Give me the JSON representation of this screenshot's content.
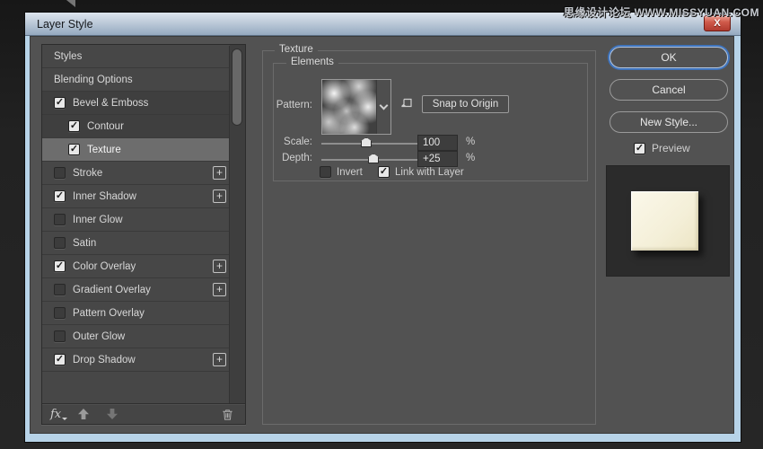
{
  "background": {
    "watermark": "思缘设计论坛 WWW.MISSYUAN.COM"
  },
  "dialog": {
    "title": "Layer Style"
  },
  "sidebar": {
    "items": [
      {
        "label": "Styles",
        "checkbox": null,
        "indent": false,
        "selected": false,
        "plus": false,
        "dark": false
      },
      {
        "label": "Blending Options",
        "checkbox": null,
        "indent": false,
        "selected": false,
        "plus": false,
        "dark": false
      },
      {
        "label": "Bevel & Emboss",
        "checkbox": true,
        "indent": false,
        "selected": false,
        "plus": false,
        "dark": true
      },
      {
        "label": "Contour",
        "checkbox": true,
        "indent": true,
        "selected": false,
        "plus": false,
        "dark": true
      },
      {
        "label": "Texture",
        "checkbox": true,
        "indent": true,
        "selected": true,
        "plus": false,
        "dark": false
      },
      {
        "label": "Stroke",
        "checkbox": false,
        "indent": false,
        "selected": false,
        "plus": true,
        "dark": false
      },
      {
        "label": "Inner Shadow",
        "checkbox": true,
        "indent": false,
        "selected": false,
        "plus": true,
        "dark": false
      },
      {
        "label": "Inner Glow",
        "checkbox": false,
        "indent": false,
        "selected": false,
        "plus": false,
        "dark": false
      },
      {
        "label": "Satin",
        "checkbox": false,
        "indent": false,
        "selected": false,
        "plus": false,
        "dark": false
      },
      {
        "label": "Color Overlay",
        "checkbox": true,
        "indent": false,
        "selected": false,
        "plus": true,
        "dark": false
      },
      {
        "label": "Gradient Overlay",
        "checkbox": false,
        "indent": false,
        "selected": false,
        "plus": true,
        "dark": false
      },
      {
        "label": "Pattern Overlay",
        "checkbox": false,
        "indent": false,
        "selected": false,
        "plus": false,
        "dark": false
      },
      {
        "label": "Outer Glow",
        "checkbox": false,
        "indent": false,
        "selected": false,
        "plus": false,
        "dark": false
      },
      {
        "label": "Drop Shadow",
        "checkbox": true,
        "indent": false,
        "selected": false,
        "plus": true,
        "dark": false
      }
    ],
    "footer": {
      "fx_label": "fx"
    }
  },
  "main": {
    "panel_title": "Texture",
    "group_title": "Elements",
    "pattern": {
      "label": "Pattern:"
    },
    "snap_button_label": "Snap to Origin",
    "scale": {
      "label": "Scale:",
      "value": "100",
      "unit": "%"
    },
    "depth": {
      "label": "Depth:",
      "value": "+25",
      "unit": "%"
    },
    "invert": {
      "label": "Invert",
      "checked": false
    },
    "link_with_layer": {
      "label": "Link with Layer",
      "checked": true
    }
  },
  "actions": {
    "ok_label": "OK",
    "cancel_label": "Cancel",
    "new_style_label": "New Style...",
    "close_label": "X",
    "preview": {
      "label": "Preview",
      "checked": true
    }
  },
  "colors": {
    "accent_blue": "#3f74bd",
    "frame_blue": "#b7d3e8",
    "body_gray": "#525252",
    "preview_swatch": "#f4f0da"
  }
}
